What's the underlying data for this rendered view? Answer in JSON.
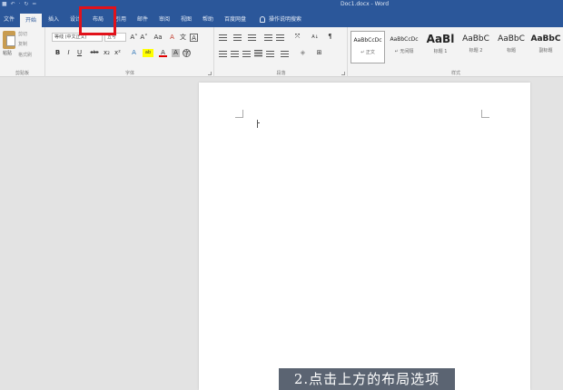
{
  "titlebar": {
    "quick_access": "■  ↶ · ↻  =",
    "document_title": "Doc1.docx  -  Word"
  },
  "tabs": [
    {
      "label": "文件",
      "active": false
    },
    {
      "label": "开始",
      "active": true
    },
    {
      "label": "插入",
      "active": false
    },
    {
      "label": "设计",
      "active": false
    },
    {
      "label": "布局",
      "active": false
    },
    {
      "label": "引用",
      "active": false
    },
    {
      "label": "邮件",
      "active": false
    },
    {
      "label": "审阅",
      "active": false
    },
    {
      "label": "视图",
      "active": false
    },
    {
      "label": "帮助",
      "active": false
    },
    {
      "label": "百度网盘",
      "active": false
    }
  ],
  "tell_me": "操作说明搜索",
  "highlight_color": "#e2121b",
  "clipboard": {
    "paste": "粘贴",
    "cut": "剪切",
    "copy": "复制",
    "format_painter": "格式刷",
    "group_label": "剪贴板"
  },
  "font": {
    "font_name": "等线 (中文正文)",
    "font_size": "五号",
    "group_label": "字体",
    "grow": "A˄",
    "shrink": "A˅",
    "case": "Aa",
    "clear": "A",
    "phonetic": "文",
    "border": "A",
    "bold": "B",
    "italic": "I",
    "underline": "U",
    "strikethrough": "abc",
    "subscript": "x₂",
    "superscript": "x²",
    "effects": "A",
    "highlight": "ab",
    "font_color": "A",
    "shading": "A",
    "enclose": "字"
  },
  "paragraph": {
    "group_label": "段落",
    "sort": "A↓",
    "show_marks": "¶"
  },
  "styles": {
    "group_label": "样式",
    "items": [
      {
        "preview": "AaBbCcDc",
        "name": "↵ 正文"
      },
      {
        "preview": "AaBbCcDc",
        "name": "↵ 无间隔"
      },
      {
        "preview": "AaBl",
        "name": "标题 1"
      },
      {
        "preview": "AaBbC",
        "name": "标题 2"
      },
      {
        "preview": "AaBbC",
        "name": "标题"
      },
      {
        "preview": "AaBbC",
        "name": "副标题"
      }
    ]
  },
  "caption": "2.点击上方的布局选项"
}
